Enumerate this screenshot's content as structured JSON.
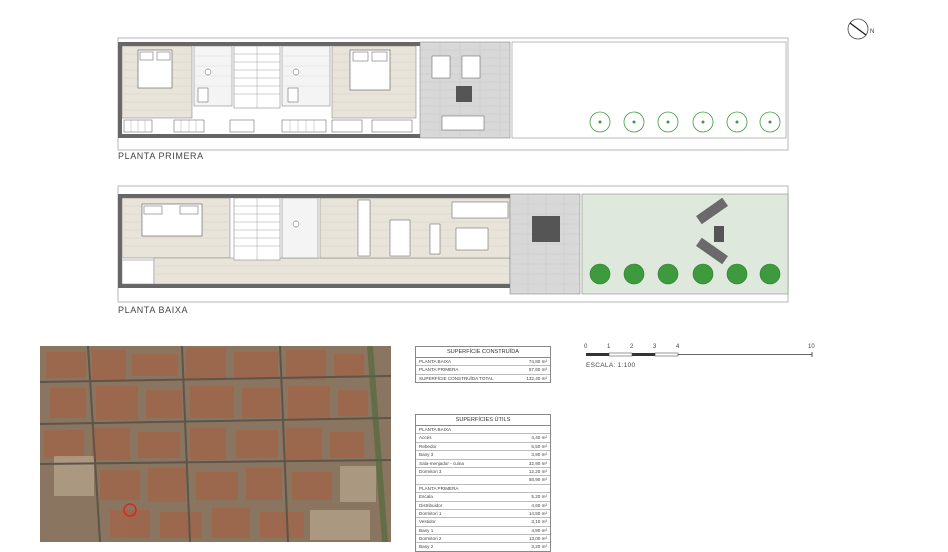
{
  "plans": {
    "upper_label": "PLANTA PRIMERA",
    "lower_label": "PLANTA BAIXA"
  },
  "built_area": {
    "title": "SUPERFÍCIE CONSTRUÏDA",
    "rows": [
      {
        "name": "PLANTA BAIXA",
        "value": "74,80 m²"
      },
      {
        "name": "PLANTA PRIMERA",
        "value": "57,60 m²"
      },
      {
        "name": "SUPERFÍCIE CONSTRUÏDA TOTAL",
        "value": "132,40 m²"
      }
    ]
  },
  "useful_area": {
    "title": "SUPERFÍCIES ÚTILS",
    "rows": [
      {
        "name": "PLANTA BAIXA",
        "value": ""
      },
      {
        "name": "Accés",
        "value": "4,40 m²"
      },
      {
        "name": "Rebedor",
        "value": "5,50 m²"
      },
      {
        "name": "Bany 3",
        "value": "3,90 m²"
      },
      {
        "name": "Sala-menjador - cuina",
        "value": "32,90 m²"
      },
      {
        "name": "Dormitori 3",
        "value": "12,20 m²"
      },
      {
        "name": "",
        "value": "58,90 m²"
      },
      {
        "name": "PLANTA PRIMERA",
        "value": ""
      },
      {
        "name": "Escala",
        "value": "5,20 m²"
      },
      {
        "name": "Distribuidor",
        "value": "4,60 m²"
      },
      {
        "name": "Dormitori 1",
        "value": "14,50 m²"
      },
      {
        "name": "Vestidor",
        "value": "3,10 m²"
      },
      {
        "name": "Bany 1",
        "value": "4,90 m²"
      },
      {
        "name": "Dormitori 2",
        "value": "13,00 m²"
      },
      {
        "name": "Bany 2",
        "value": "3,20 m²"
      }
    ]
  },
  "scale": {
    "ticks": [
      "0",
      "1",
      "2",
      "3",
      "4",
      "10"
    ],
    "label": "ESCALA: 1:100"
  },
  "compass": {
    "north": "N"
  },
  "colors": {
    "line": "#555555",
    "wood": "#e9e4da",
    "garden": "#dfe8dc",
    "tree": "#3d9a3d",
    "paving": "#d8d8d8"
  }
}
